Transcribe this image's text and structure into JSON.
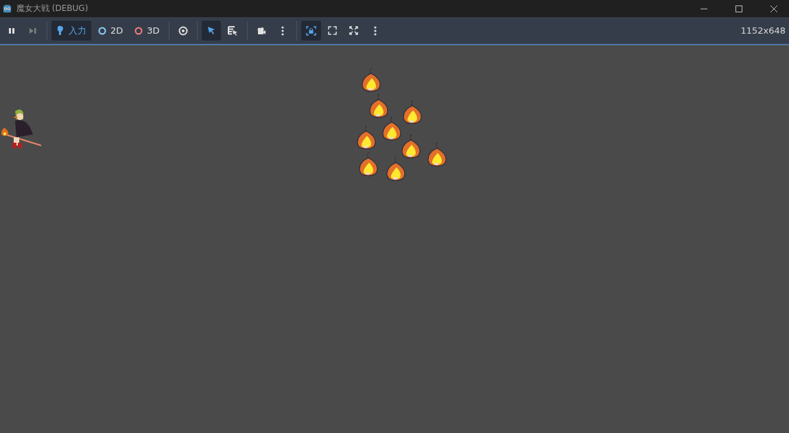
{
  "window": {
    "title": "魔女大戦 (DEBUG)"
  },
  "toolbar": {
    "input_button": {
      "label": "入力",
      "selected": true
    },
    "view_buttons": [
      {
        "label": "2D",
        "color": "#8fd3ff"
      },
      {
        "label": "3D",
        "color": "#fc7f7f"
      }
    ],
    "select_tool": {
      "selected": true
    },
    "list_select_tool": {
      "selected": false
    },
    "camera_lock": {
      "selected": true
    },
    "resolution": "1152x648"
  }
}
